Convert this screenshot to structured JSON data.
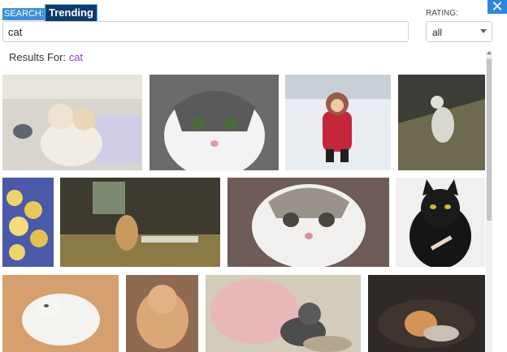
{
  "header": {
    "search_label": "SEARCH:",
    "trending_label": "Trending",
    "rating_label": "RATING:",
    "close_glyph": "✕"
  },
  "search": {
    "value": "cat"
  },
  "rating": {
    "selected": "all"
  },
  "results": {
    "prefix": "Results For: ",
    "query": "cat"
  },
  "colors": {
    "accent": "#3b8fd9",
    "trending_bg": "#0f3b6b",
    "query": "#8a3fbf"
  }
}
